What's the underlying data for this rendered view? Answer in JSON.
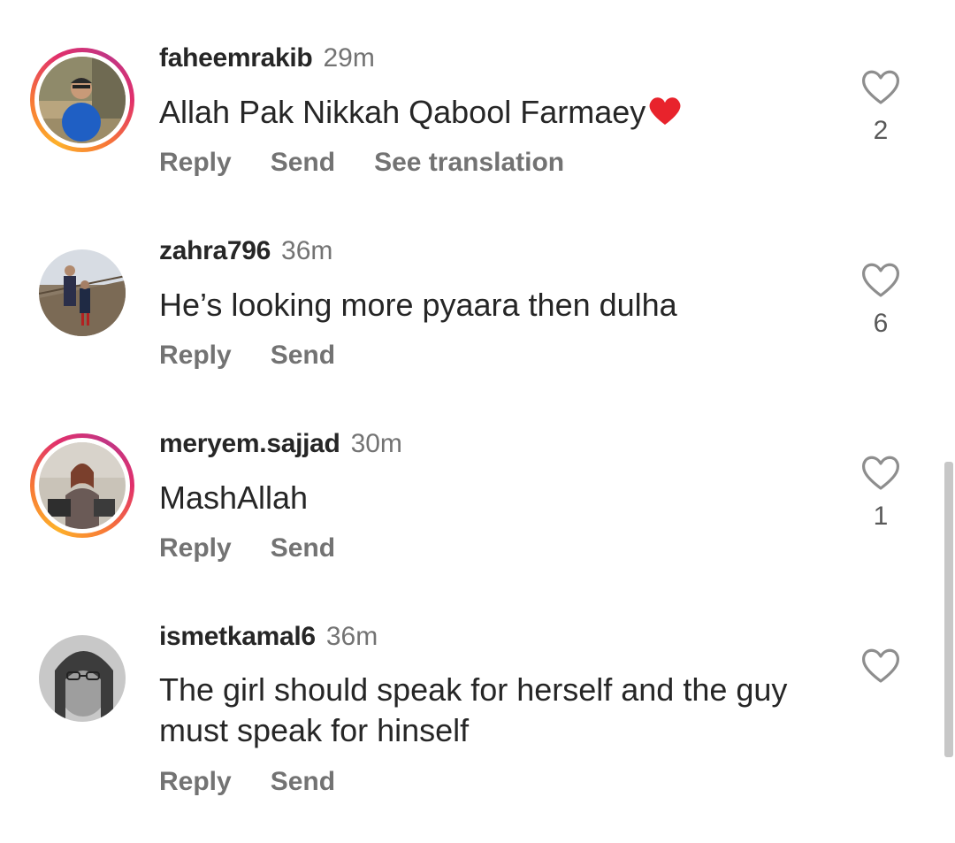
{
  "comments": [
    {
      "username": "faheemrakib",
      "time": "29m",
      "text": "Allah Pak Nikkah Qabool Farmaey",
      "emoji": "red-heart",
      "actions": [
        "Reply",
        "Send",
        "See translation"
      ],
      "likes": "2",
      "story_ring": true
    },
    {
      "username": "zahra796",
      "time": "36m",
      "text": "He’s looking more pyaara then dulha",
      "actions": [
        "Reply",
        "Send"
      ],
      "likes": "6",
      "story_ring": false
    },
    {
      "username": "meryem.sajjad",
      "time": "30m",
      "text": "MashAllah",
      "actions": [
        "Reply",
        "Send"
      ],
      "likes": "1",
      "story_ring": true
    },
    {
      "username": "ismetkamal6",
      "time": "36m",
      "text": "The girl should speak for herself and the guy must speak for hinself",
      "actions": [
        "Reply",
        "Send"
      ],
      "likes": "",
      "story_ring": false
    }
  ],
  "colors": {
    "text": "#262626",
    "secondary": "#737373",
    "heart_outline": "#8e8e8e",
    "emoji_heart": "#e8232c"
  },
  "icons": {
    "like": "heart-outline-icon",
    "emoji": "red-heart-emoji-icon"
  }
}
